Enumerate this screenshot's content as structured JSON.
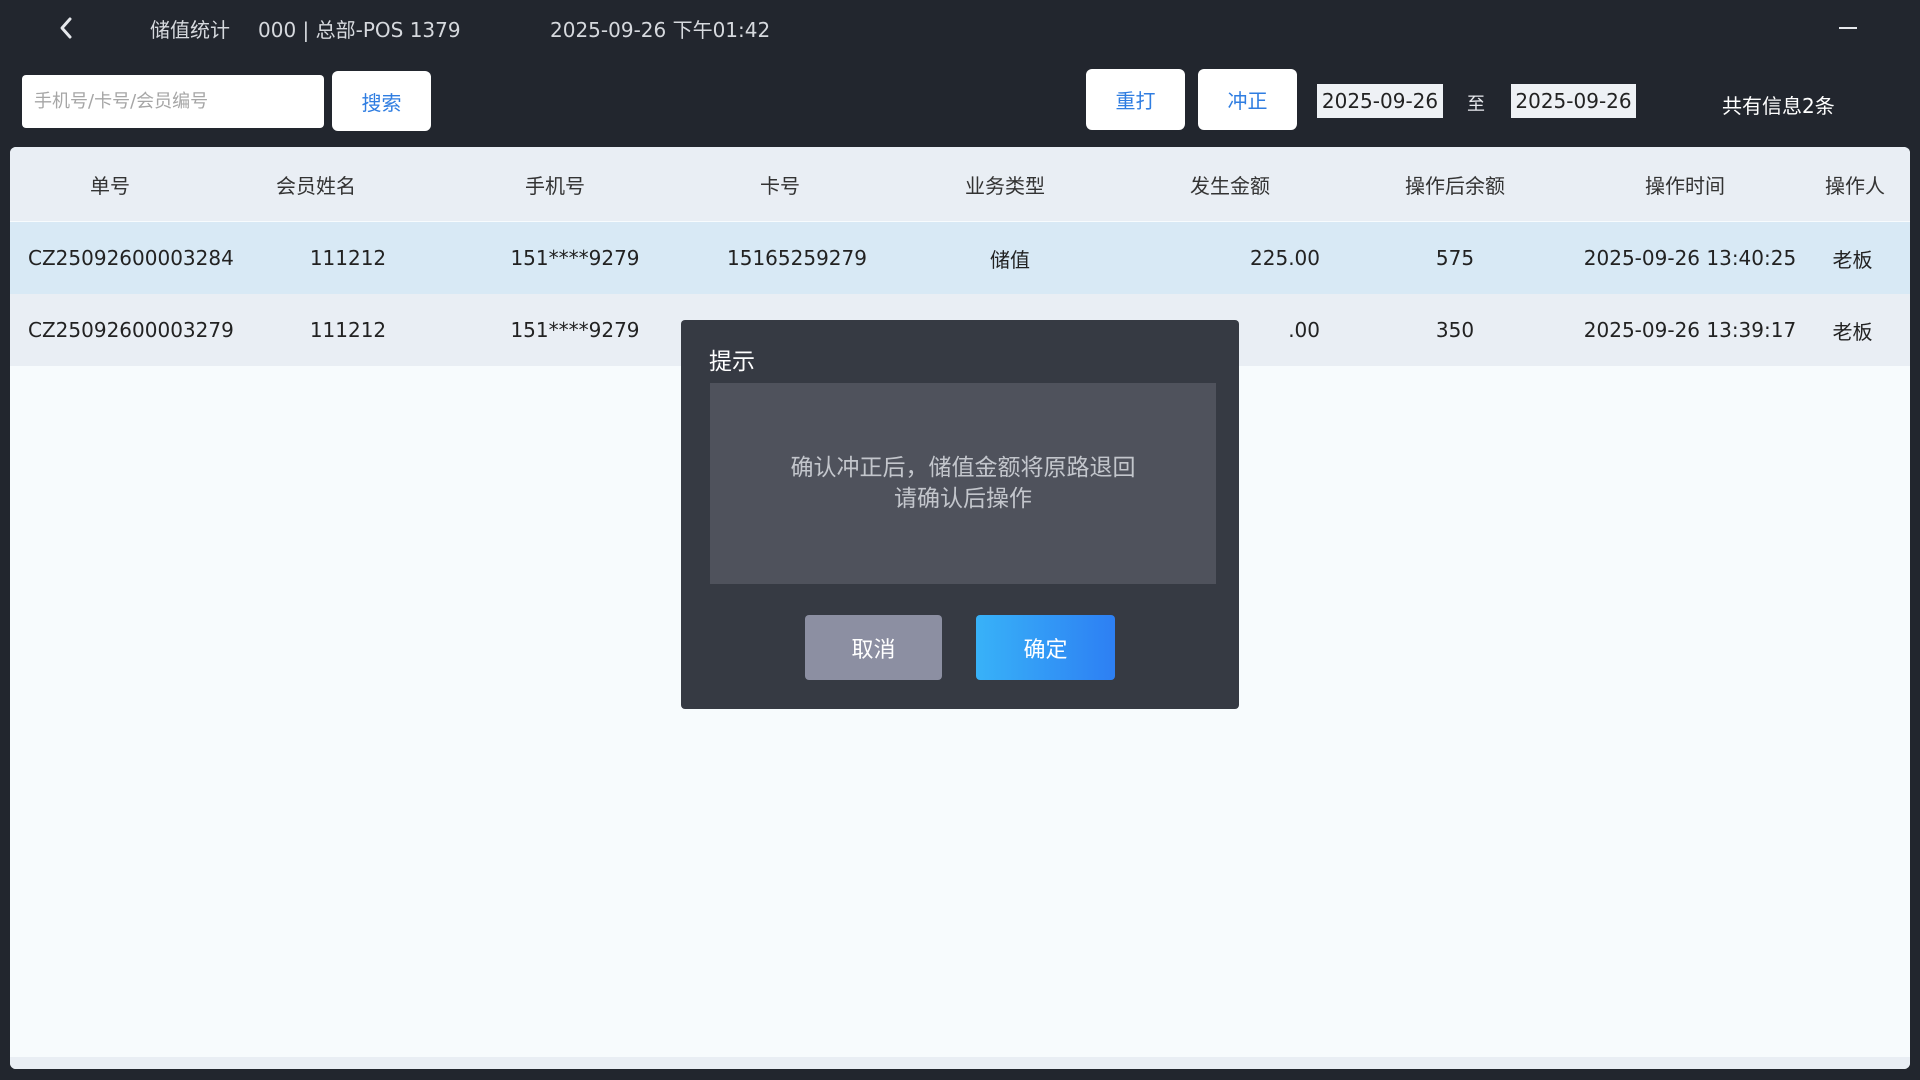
{
  "titlebar": {
    "title": "储值统计",
    "store": "000 | 总部-POS 1379",
    "datetime": "2025-09-26 下午01:42"
  },
  "toolbar": {
    "search_placeholder": "手机号/卡号/会员编号",
    "search_label": "搜索",
    "reprint_label": "重打",
    "reverse_label": "冲正",
    "date_start": "2025-09-26",
    "date_separator": "至",
    "date_end": "2025-09-26",
    "count_text": "共有信息2条"
  },
  "table": {
    "columns": [
      "单号",
      "会员姓名",
      "手机号",
      "卡号",
      "业务类型",
      "发生金额",
      "操作后余额",
      "操作时间",
      "操作人"
    ],
    "rows": [
      {
        "order_no": "CZ25092600003284",
        "member_name": "111212",
        "phone": "151****9279",
        "card_no": "15165259279",
        "biz_type": "储值",
        "amount": "225.00",
        "balance_after": "575",
        "op_time": "2025-09-26 13:40:25",
        "operator": "老板"
      },
      {
        "order_no": "CZ25092600003279",
        "member_name": "111212",
        "phone": "151****9279",
        "card_no": "",
        "biz_type": "",
        "amount": ".00",
        "balance_after": "350",
        "op_time": "2025-09-26 13:39:17",
        "operator": "老板"
      }
    ]
  },
  "dialog": {
    "title": "提示",
    "message_line1": "确认冲正后，储值金额将原路退回",
    "message_line2": "请确认后操作",
    "cancel_label": "取消",
    "ok_label": "确定"
  },
  "colors": {
    "background": "#22262e",
    "accent_blue": "#2f7de1",
    "selected_row": "#d8e9f5",
    "dialog_bg": "#363a43"
  },
  "icons": {
    "back": "chevron-left-icon",
    "minimize": "minimize-icon"
  }
}
